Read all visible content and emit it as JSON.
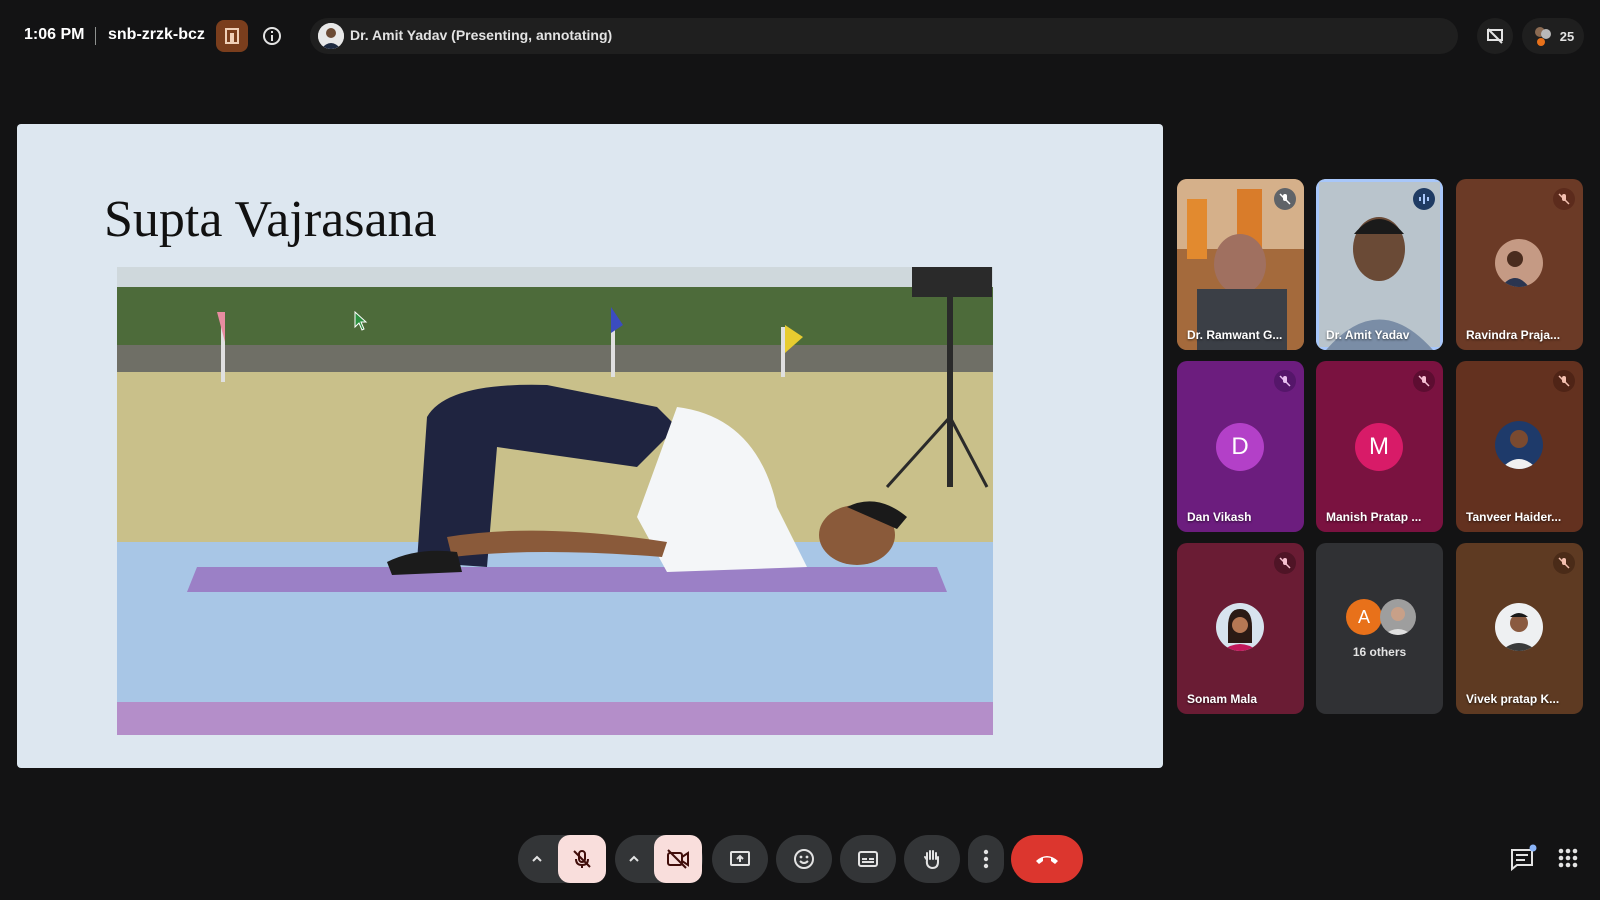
{
  "header": {
    "time": "1:06 PM",
    "meeting_code": "snb-zrzk-bcz",
    "presenter_status": "Dr. Amit Yadav (Presenting, annotating)",
    "participant_count": "25"
  },
  "slide": {
    "title": "Supta Vajrasana"
  },
  "participants": [
    {
      "name": "Dr. Ramwant G...",
      "muted": true
    },
    {
      "name": "Dr. Amit Yadav",
      "speaking": true
    },
    {
      "name": "Ravindra Praja...",
      "muted": true
    },
    {
      "name": "Dan Vikash",
      "initial": "D",
      "muted": true
    },
    {
      "name": "Manish Pratap ...",
      "initial": "M",
      "muted": true
    },
    {
      "name": "Tanveer Haider...",
      "muted": true
    },
    {
      "name": "Sonam Mala",
      "muted": true
    },
    {
      "name": "16 others",
      "initial": "A"
    },
    {
      "name": "Vivek pratap K...",
      "muted": true
    }
  ],
  "colors": {
    "background": "#131314",
    "end_call": "#dc362e",
    "muted_control": "#f9dedc",
    "active_speaker_border": "#a8c7fa"
  }
}
